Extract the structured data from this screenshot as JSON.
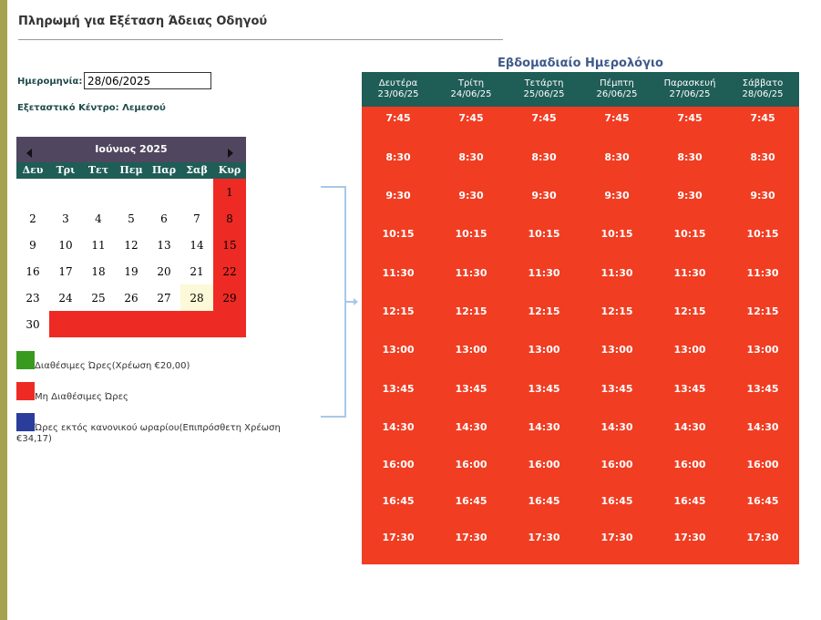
{
  "page_title": "Πληρωμή για Εξέταση Άδειας Οδηγού",
  "date_label": "Ημερομηνία:",
  "date_value": "28/06/2025",
  "center_label": "Εξεταστικό Κέντρο: Λεμεσού",
  "calendar": {
    "month_label": "Ιούνιος 2025",
    "weekdays": [
      "Δευ",
      "Τρι",
      "Τετ",
      "Πεμ",
      "Παρ",
      "Σαβ",
      "Κυρ"
    ],
    "weeks": [
      [
        "",
        "",
        "",
        "",
        "",
        "",
        "1"
      ],
      [
        "2",
        "3",
        "4",
        "5",
        "6",
        "7",
        "8"
      ],
      [
        "9",
        "10",
        "11",
        "12",
        "13",
        "14",
        "15"
      ],
      [
        "16",
        "17",
        "18",
        "19",
        "20",
        "21",
        "22"
      ],
      [
        "23",
        "24",
        "25",
        "26",
        "27",
        "28",
        "29"
      ],
      [
        "30",
        "",
        "",
        "",
        "",
        "",
        ""
      ]
    ],
    "selected_day": "28"
  },
  "legend": {
    "available": "Διαθέσιμες Ώρες(Χρέωση €20,00)",
    "unavailable": "Μη Διαθέσιμες Ώρες",
    "outside_hours": "Ώρες εκτός κανονικού ωραρίου(Επιπρόσθετη Χρέωση €34,17)"
  },
  "colors": {
    "available": "#3a9a20",
    "unavailable": "#ee2a24",
    "outside_hours": "#2b3d9b",
    "header": "#1f5d57",
    "calendar_header": "#514660",
    "slots_background": "#f13d22"
  },
  "weekly_calendar": {
    "title": "Εβδομαδιαίο Ημερολόγιο",
    "days": [
      {
        "name": "Δευτέρα",
        "date": "23/06/25"
      },
      {
        "name": "Τρίτη",
        "date": "24/06/25"
      },
      {
        "name": "Τετάρτη",
        "date": "25/06/25"
      },
      {
        "name": "Πέμπτη",
        "date": "26/06/25"
      },
      {
        "name": "Παρασκευή",
        "date": "27/06/25"
      },
      {
        "name": "Σάββατο",
        "date": "28/06/25"
      }
    ],
    "times": [
      "7:45",
      "8:30",
      "9:30",
      "10:15",
      "11:30",
      "12:15",
      "13:00",
      "13:45",
      "14:30",
      "16:00",
      "16:45",
      "17:30"
    ]
  }
}
